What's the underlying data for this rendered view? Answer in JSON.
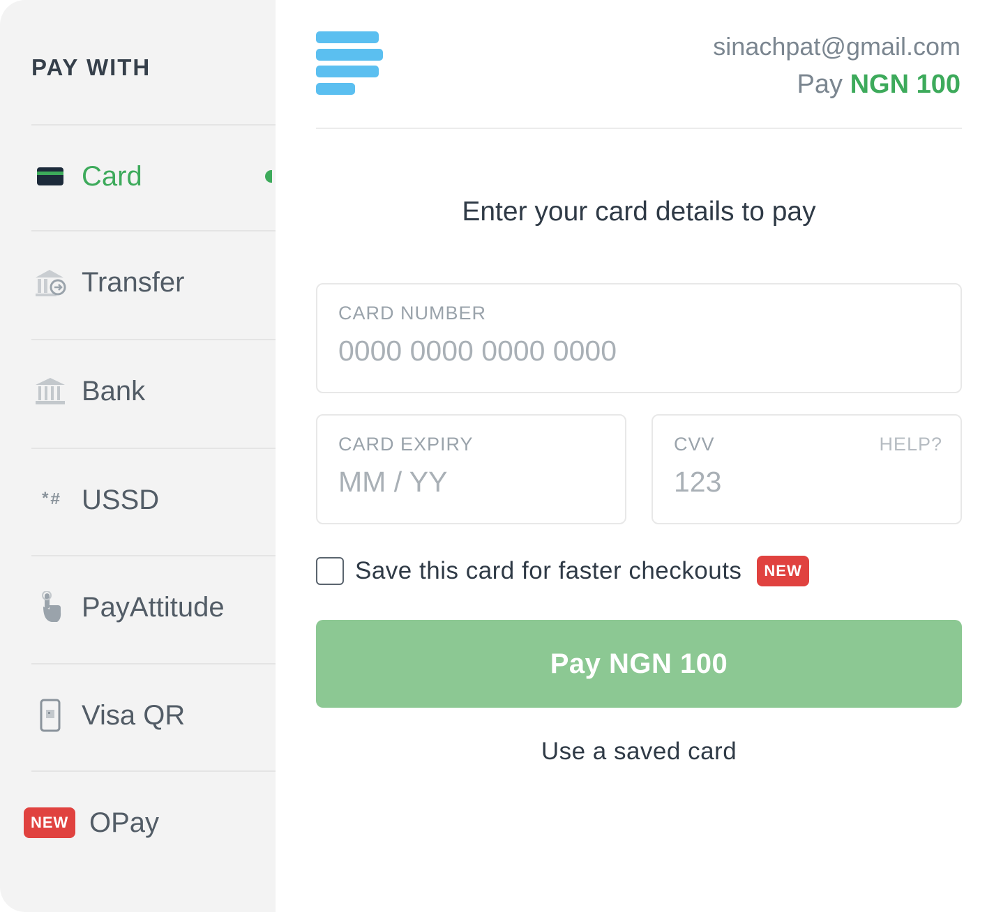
{
  "sidebar": {
    "heading": "PAY WITH",
    "items": [
      {
        "label": "Card",
        "icon": "card-icon",
        "active": true
      },
      {
        "label": "Transfer",
        "icon": "bank-transfer-icon"
      },
      {
        "label": "Bank",
        "icon": "bank-icon"
      },
      {
        "label": "USSD",
        "icon": "ussd-icon",
        "icon_text": "*#"
      },
      {
        "label": "PayAttitude",
        "icon": "touch-hand-icon"
      },
      {
        "label": "Visa QR",
        "icon": "phone-qr-icon"
      },
      {
        "label": "OPay",
        "badge": "NEW"
      }
    ]
  },
  "header": {
    "email": "sinachpat@gmail.com",
    "pay_prefix": "Pay",
    "amount": "NGN 100"
  },
  "form": {
    "heading": "Enter your card details to pay",
    "card_number": {
      "label": "CARD NUMBER",
      "placeholder": "0000 0000 0000 0000"
    },
    "card_expiry": {
      "label": "CARD EXPIRY",
      "placeholder": "MM / YY"
    },
    "cvv": {
      "label": "CVV",
      "help": "HELP?",
      "placeholder": "123"
    },
    "save_card": {
      "label": "Save this card for faster checkouts",
      "badge": "NEW",
      "checked": false
    },
    "pay_button": "Pay NGN 100",
    "saved_card_link": "Use a saved card"
  },
  "colors": {
    "accent_green": "#3daa5b",
    "button_green": "#8cc893",
    "badge_red": "#e0423f",
    "logo_blue": "#5bbff0",
    "sidebar_bg": "#f3f3f3"
  }
}
